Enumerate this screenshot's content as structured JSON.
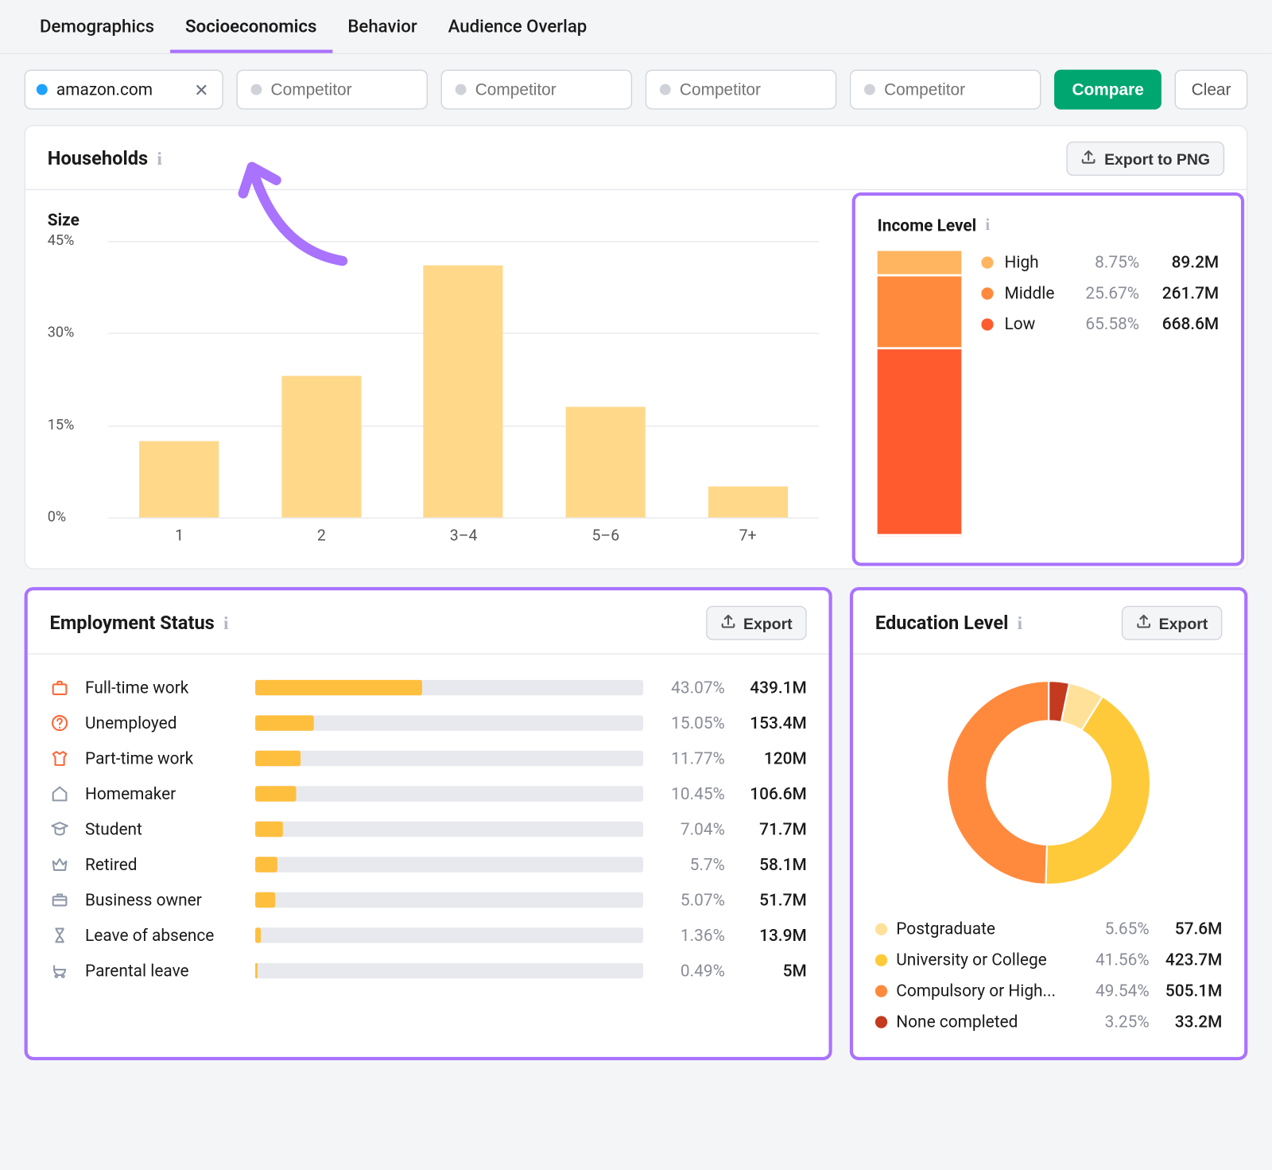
{
  "tabs": {
    "demographics": "Demographics",
    "socioeconomics": "Socioeconomics",
    "behavior": "Behavior",
    "overlap": "Audience Overlap"
  },
  "toolbar": {
    "domain": "amazon.com",
    "comp_placeholder": "Competitor",
    "compare": "Compare",
    "clear": "Clear"
  },
  "households": {
    "title": "Households",
    "export": "Export to PNG",
    "size_title": "Size",
    "income_title": "Income Level"
  },
  "chart_data": {
    "household_size": {
      "type": "bar",
      "title": "Size",
      "ylabel": "%",
      "ylim": [
        0,
        45
      ],
      "yticks": [
        "0%",
        "15%",
        "30%",
        "45%"
      ],
      "categories": [
        "1",
        "2",
        "3–4",
        "5–6",
        "7+"
      ],
      "values": [
        12.5,
        23,
        41,
        18,
        5
      ]
    },
    "income": {
      "type": "stacked-bar",
      "series": [
        {
          "name": "High",
          "pct": "8.75%",
          "abs": "89.2M",
          "color": "#ffb55f",
          "value": 8.75
        },
        {
          "name": "Middle",
          "pct": "25.67%",
          "abs": "261.7M",
          "color": "#ff8a3d",
          "value": 25.67
        },
        {
          "name": "Low",
          "pct": "65.58%",
          "abs": "668.6M",
          "color": "#ff5b2e",
          "value": 65.58
        }
      ]
    },
    "employment": {
      "type": "bar",
      "items": [
        {
          "label": "Full-time work",
          "pct": "43.07%",
          "abs": "439.1M",
          "value": 43.07,
          "icon": "briefcase",
          "color": "orange"
        },
        {
          "label": "Unemployed",
          "pct": "15.05%",
          "abs": "153.4M",
          "value": 15.05,
          "icon": "help",
          "color": "orange"
        },
        {
          "label": "Part-time work",
          "pct": "11.77%",
          "abs": "120M",
          "value": 11.77,
          "icon": "shirt",
          "color": "orange"
        },
        {
          "label": "Homemaker",
          "pct": "10.45%",
          "abs": "106.6M",
          "value": 10.45,
          "icon": "house",
          "color": "grey"
        },
        {
          "label": "Student",
          "pct": "7.04%",
          "abs": "71.7M",
          "value": 7.04,
          "icon": "grad",
          "color": "grey"
        },
        {
          "label": "Retired",
          "pct": "5.7%",
          "abs": "58.1M",
          "value": 5.7,
          "icon": "crown",
          "color": "grey"
        },
        {
          "label": "Business owner",
          "pct": "5.07%",
          "abs": "51.7M",
          "value": 5.07,
          "icon": "bag",
          "color": "grey"
        },
        {
          "label": "Leave of absence",
          "pct": "1.36%",
          "abs": "13.9M",
          "value": 1.36,
          "icon": "hourglass",
          "color": "grey"
        },
        {
          "label": "Parental leave",
          "pct": "0.49%",
          "abs": "5M",
          "value": 0.49,
          "icon": "stroller",
          "color": "grey"
        }
      ]
    },
    "education": {
      "type": "pie",
      "items": [
        {
          "label": "Postgraduate",
          "pct": "5.65%",
          "abs": "57.6M",
          "value": 5.65,
          "color": "#ffe19a"
        },
        {
          "label": "University or College",
          "pct": "41.56%",
          "abs": "423.7M",
          "value": 41.56,
          "color": "#ffca3a"
        },
        {
          "label": "Compulsory or High...",
          "pct": "49.54%",
          "abs": "505.1M",
          "value": 49.54,
          "color": "#ff8a3d"
        },
        {
          "label": "None completed",
          "pct": "3.25%",
          "abs": "33.2M",
          "value": 3.25,
          "color": "#c43a1e"
        }
      ]
    }
  },
  "employment_title": "Employment Status",
  "education_title": "Education Level",
  "export_short": "Export"
}
